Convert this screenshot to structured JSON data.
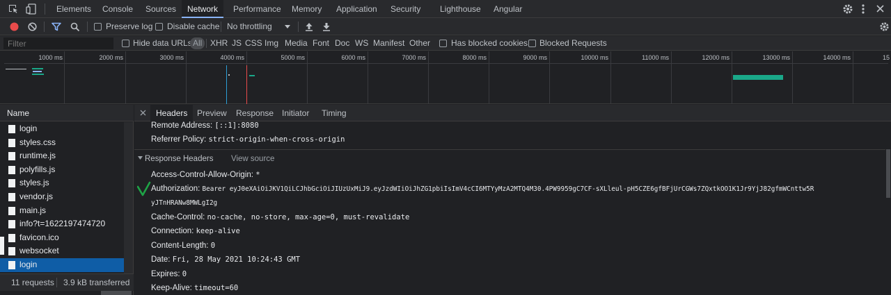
{
  "tabs": [
    "Elements",
    "Console",
    "Sources",
    "Network",
    "Performance",
    "Memory",
    "Application",
    "Security",
    "Lighthouse",
    "Angular"
  ],
  "toolbar": {
    "preserve_log": "Preserve log",
    "disable_cache": "Disable cache",
    "throttling": "No throttling"
  },
  "filter": {
    "placeholder": "Filter",
    "hide_data_urls": "Hide data URLs",
    "types": [
      "All",
      "XHR",
      "JS",
      "CSS",
      "Img",
      "Media",
      "Font",
      "Doc",
      "WS",
      "Manifest",
      "Other"
    ],
    "has_blocked_cookies": "Has blocked cookies",
    "blocked_requests": "Blocked Requests"
  },
  "timeline": {
    "ticks": [
      "1000 ms",
      "2000 ms",
      "3000 ms",
      "4000 ms",
      "5000 ms",
      "6000 ms",
      "7000 ms",
      "8000 ms",
      "9000 ms",
      "10000 ms",
      "11000 ms",
      "12000 ms",
      "13000 ms",
      "14000 ms",
      "15"
    ]
  },
  "requests": {
    "header": "Name",
    "items": [
      "login",
      "styles.css",
      "runtime.js",
      "polyfills.js",
      "styles.js",
      "vendor.js",
      "main.js",
      "info?t=1622197474720",
      "favicon.ico",
      "websocket",
      "login"
    ],
    "selected_index": 10,
    "summary_count": "11 requests",
    "summary_transferred": "3.9 kB transferred"
  },
  "detail": {
    "tabs": [
      "Headers",
      "Preview",
      "Response",
      "Initiator",
      "Timing"
    ],
    "general": [
      {
        "key": "Remote Address:",
        "value": "[::1]:8080"
      },
      {
        "key": "Referrer Policy:",
        "value": "strict-origin-when-cross-origin"
      }
    ],
    "response_headers_title": "Response Headers",
    "view_source": "View source",
    "response_headers": [
      {
        "key": "Access-Control-Allow-Origin:",
        "value": "*"
      },
      {
        "key": "Authorization:",
        "value": "Bearer eyJ0eXAiOiJKV1QiLCJhbGciOiJIUzUxMiJ9.eyJzdWIiOiJhZG1pbiIsImV4cCI6MTYyMzA2MTQ4M30.4PW9959gC7CF-sXLleul-pH5CZE6gfBFjUrCGWs7ZQxtkOO1K1Jr9YjJ82gfmWCnttw5R",
        "value_cont": "yJTnHRANw8MWLgI2g"
      },
      {
        "key": "Cache-Control:",
        "value": "no-cache, no-store, max-age=0, must-revalidate"
      },
      {
        "key": "Connection:",
        "value": "keep-alive"
      },
      {
        "key": "Content-Length:",
        "value": "0"
      },
      {
        "key": "Date:",
        "value": "Fri, 28 May 2021 10:24:43 GMT"
      },
      {
        "key": "Expires:",
        "value": "0"
      },
      {
        "key": "Keep-Alive:",
        "value": "timeout=60"
      }
    ]
  },
  "colors": {
    "accent": "#8ab4f8",
    "record": "#e94b4b",
    "selected_row": "#0f5da6",
    "checkmark": "#1ea446",
    "timeline_bar": "#1aa889"
  }
}
